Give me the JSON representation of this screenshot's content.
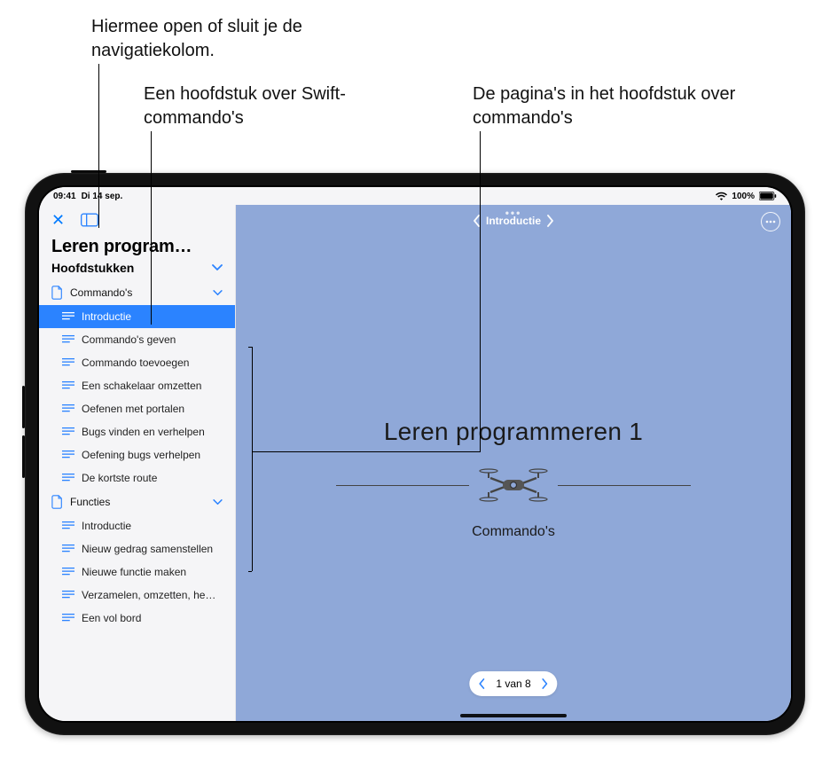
{
  "callouts": {
    "navToggle": "Hiermee open of sluit je de navigatiekolom.",
    "swiftChapter": "Een hoofdstuk over Swift-commando's",
    "chapterPages": "De pagina's in het hoofdstuk over commando's"
  },
  "status": {
    "time": "09:41",
    "date": "Di 14 sep.",
    "battery": "100%"
  },
  "sidebar": {
    "title": "Leren program…",
    "sectionHeader": "Hoofdstukken",
    "chapters": [
      {
        "name": "Commando's",
        "pages": [
          "Introductie",
          "Commando's geven",
          "Commando toevoegen",
          "Een schakelaar omzetten",
          "Oefenen met portalen",
          "Bugs vinden en verhelpen",
          "Oefening bugs verhelpen",
          "De kortste route"
        ],
        "selectedIndex": 0
      },
      {
        "name": "Functies",
        "pages": [
          "Introductie",
          "Nieuw gedrag samenstellen",
          "Nieuwe functie maken",
          "Verzamelen, omzetten, he…",
          "Een vol bord"
        ]
      }
    ]
  },
  "main": {
    "topNavLabel": "Introductie",
    "courseTitle": "Leren programmeren 1",
    "chapterTitle": "Commando's",
    "pager": "1 van 8"
  }
}
